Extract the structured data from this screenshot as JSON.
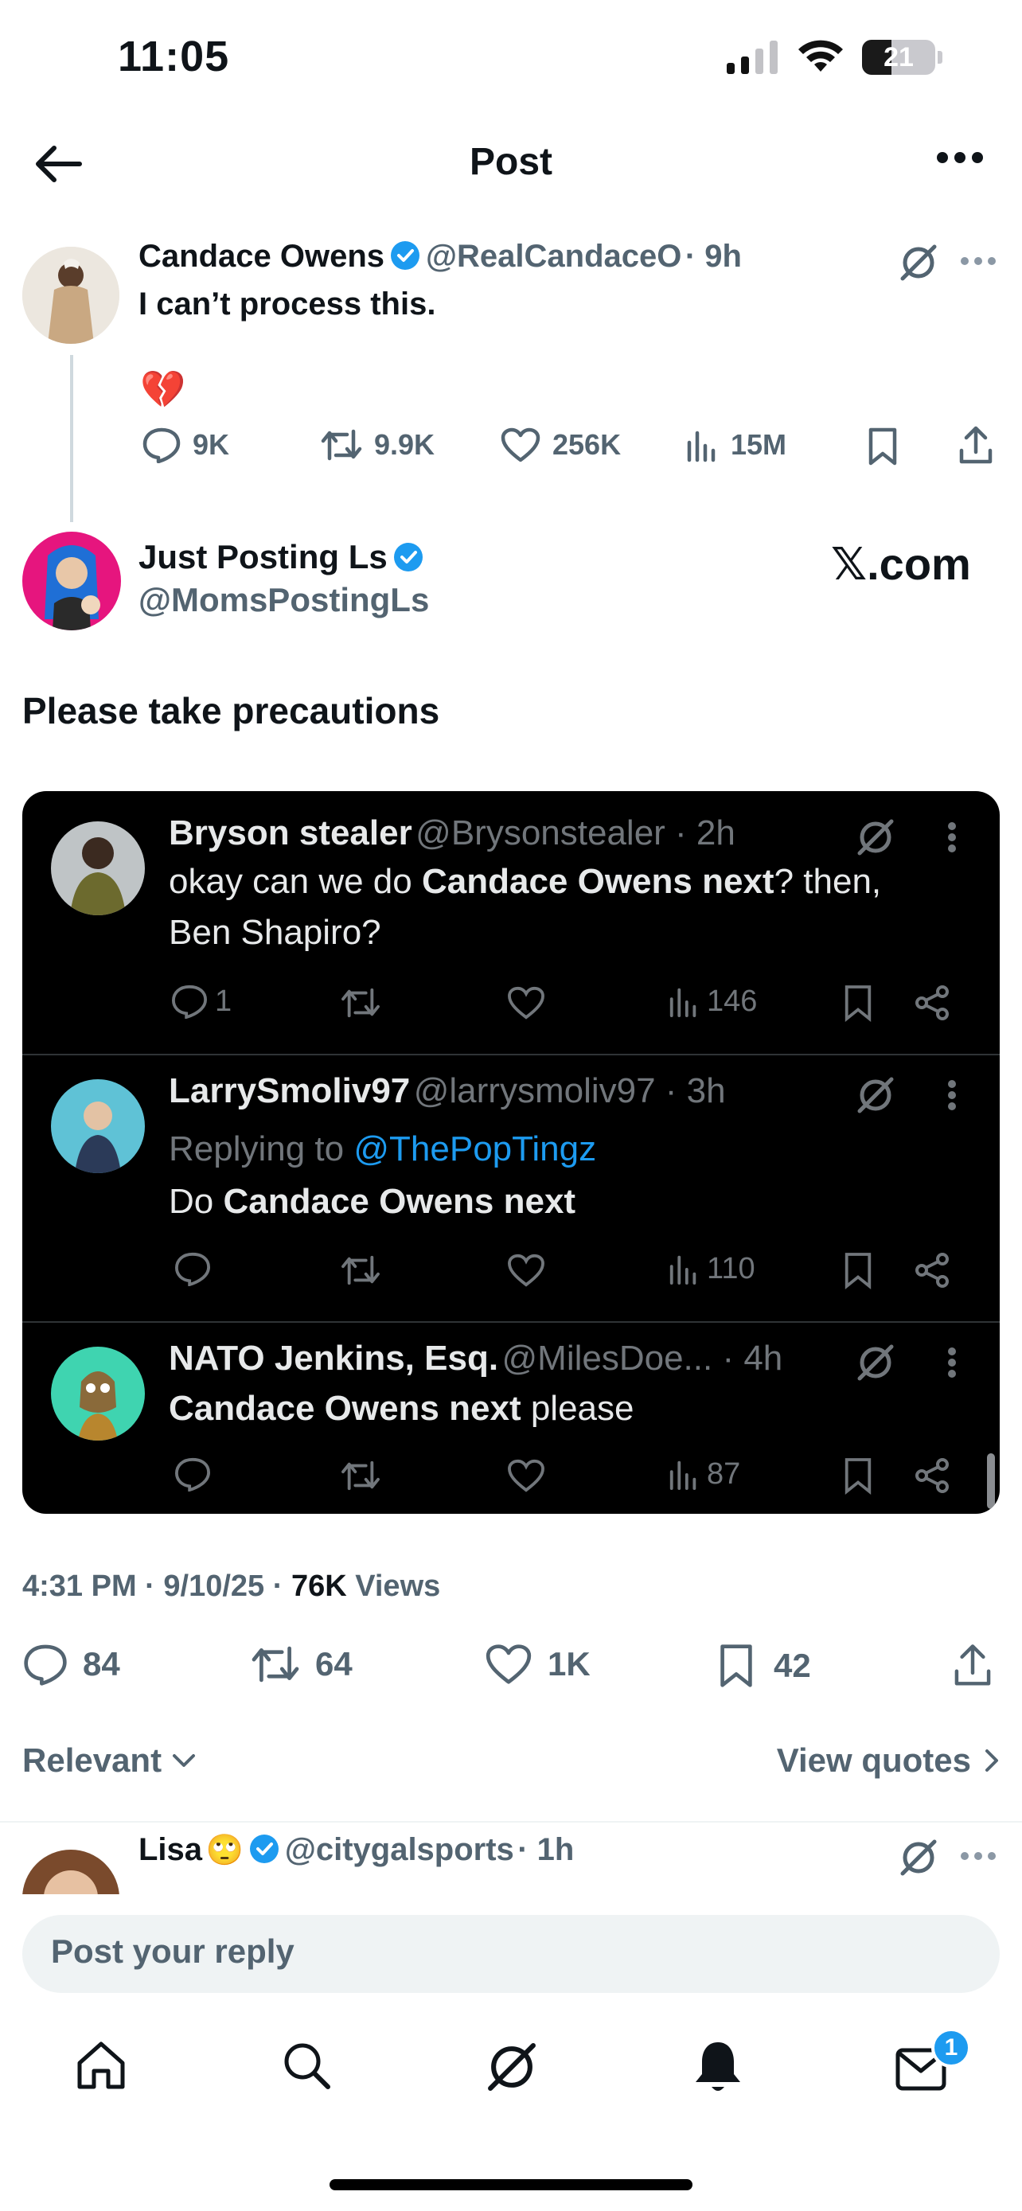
{
  "status_bar": {
    "time": "11:05",
    "battery": "21"
  },
  "header": {
    "title": "Post"
  },
  "parent_post": {
    "name": "Candace Owens",
    "handle": "@RealCandaceO",
    "time": "· 9h",
    "text": "I can’t process this.",
    "emoji": "💔",
    "stats": {
      "replies": "9K",
      "reposts": "9.9K",
      "likes": "256K",
      "views": "15M"
    }
  },
  "main_post": {
    "name": "Just Posting Ls",
    "handle": "@MomsPostingLs",
    "watermark": "𝕏.com",
    "text": "Please take precautions",
    "meta": {
      "time": "4:31 PM · 9/10/25 · ",
      "views_count": "76K",
      "views_label": " Views"
    },
    "stats": {
      "replies": "84",
      "reposts": "64",
      "likes": "1K",
      "bookmarks": "42"
    }
  },
  "embedded": [
    {
      "name": "Bryson stealer",
      "handle": "@Brysonstealer · 2h",
      "text_a": "okay can we do ",
      "text_b": "Candace Owens next",
      "text_c": "? then,",
      "text_d": "Ben Shapiro?",
      "replies": "1",
      "views": "146"
    },
    {
      "name": "LarrySmoliv97",
      "handle": "@larrysmoliv97 · 3h",
      "replying_label": "Replying to ",
      "replying_handle": "@ThePopTingz",
      "text_a": "Do ",
      "text_b": "Candace Owens next",
      "views": "110"
    },
    {
      "name": "NATO Jenkins, Esq.",
      "handle": "@MilesDoe... · 4h",
      "text_b": "Candace Owens next",
      "text_c": " please",
      "views": "87"
    }
  ],
  "replies_bar": {
    "sort": "Relevant",
    "quotes": "View quotes"
  },
  "reply_preview": {
    "name": "Lisa",
    "emoji": "🙄",
    "handle": "@citygalsports",
    "time": "· 1h"
  },
  "composer": {
    "placeholder": "Post your reply"
  },
  "tabbar": {
    "messages_badge": "1"
  },
  "colors": {
    "accent": "#1d9bf0",
    "text": "#0f1419",
    "muted": "#536471"
  }
}
